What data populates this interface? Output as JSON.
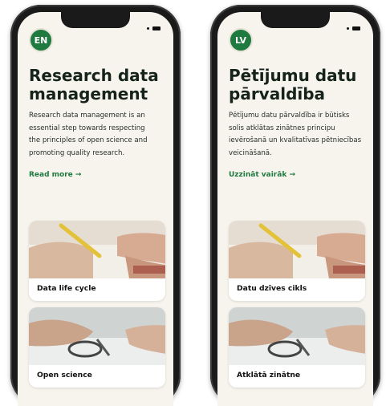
{
  "phones": [
    {
      "lang": "EN",
      "title_line1": "Research data",
      "title_line2": "management",
      "description_lines": [
        "Research data management is an",
        "essential step towards respecting",
        "the principles of open science and",
        "promoting quality research."
      ],
      "read_more": "Read more →",
      "cards": [
        {
          "label": "Data life cycle",
          "image": "hands-writing-pencil-photo"
        },
        {
          "label": "Open science",
          "image": "hands-with-eyeglasses-photo"
        }
      ]
    },
    {
      "lang": "LV",
      "title_line1": "Pētījumu datu",
      "title_line2": "pārvaldība",
      "description_lines": [
        "Pētījumu datu pārvaldība ir būtisks",
        "solis atklātas zinātnes principu",
        "ievērošanā un kvalitatīvas pētniecības",
        "veicināšanā."
      ],
      "read_more": "Uzzināt vairāk →",
      "cards": [
        {
          "label": "Datu dzīves cikls",
          "image": "hands-writing-pencil-photo"
        },
        {
          "label": "Atklātā zinātne",
          "image": "hands-with-eyeglasses-photo"
        }
      ]
    }
  ],
  "colors": {
    "accent": "#1f7a3f",
    "screen_bg": "#f7f4ee",
    "frame": "#1a1a1a"
  }
}
